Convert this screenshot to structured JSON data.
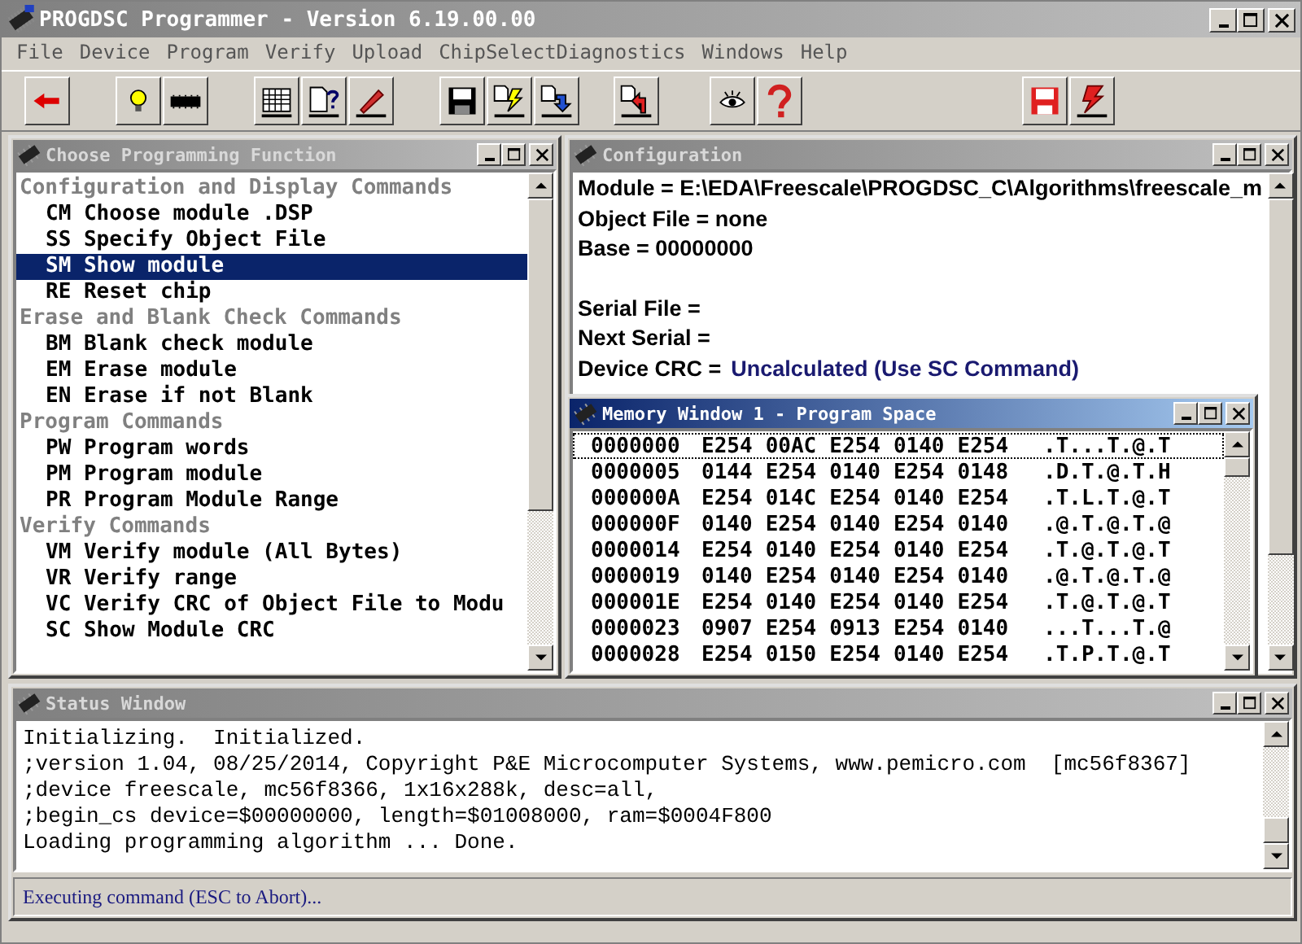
{
  "window": {
    "title": "PROGDSC Programmer - Version 6.19.00.00"
  },
  "menu": [
    "File",
    "Device",
    "Program",
    "Verify",
    "Upload",
    "ChipSelectDiagnostics",
    "Windows",
    "Help"
  ],
  "function_window": {
    "title": "Choose Programming Function",
    "active": false,
    "items": [
      {
        "kind": "header",
        "text": "Configuration and Display Commands",
        "selected": false
      },
      {
        "kind": "command",
        "text": "CM Choose module .DSP",
        "selected": false
      },
      {
        "kind": "command",
        "text": "SS Specify Object File",
        "selected": false
      },
      {
        "kind": "command",
        "text": "SM Show module",
        "selected": true
      },
      {
        "kind": "command",
        "text": "RE Reset chip",
        "selected": false
      },
      {
        "kind": "header",
        "text": "Erase and Blank Check Commands",
        "selected": false
      },
      {
        "kind": "command",
        "text": "BM Blank check module",
        "selected": false
      },
      {
        "kind": "command",
        "text": "EM Erase module",
        "selected": false
      },
      {
        "kind": "command",
        "text": "EN Erase if not Blank",
        "selected": false
      },
      {
        "kind": "header",
        "text": "Program Commands",
        "selected": false
      },
      {
        "kind": "command",
        "text": "PW Program words",
        "selected": false
      },
      {
        "kind": "command",
        "text": "PM Program module",
        "selected": false
      },
      {
        "kind": "command",
        "text": "PR Program Module Range",
        "selected": false
      },
      {
        "kind": "header",
        "text": "Verify Commands",
        "selected": false
      },
      {
        "kind": "command",
        "text": "VM Verify module (All Bytes)",
        "selected": false
      },
      {
        "kind": "command",
        "text": "VR Verify range",
        "selected": false
      },
      {
        "kind": "command",
        "text": "VC Verify CRC of Object File to Modu",
        "selected": false
      },
      {
        "kind": "command",
        "text": "SC Show Module CRC",
        "selected": false
      }
    ]
  },
  "config_window": {
    "title": "Configuration",
    "active": false,
    "groups": [
      [
        {
          "label": "Module = E:\\EDA\\Freescale\\PROGDSC_C\\Algorithms\\freescale_m"
        },
        {
          "label": "Object File = none"
        },
        {
          "label": "Base = 00000000"
        }
      ],
      [
        {
          "label": "Serial File ="
        },
        {
          "label": "Next Serial ="
        },
        {
          "label": "Device CRC =",
          "value": "Uncalculated (Use SC Command)"
        }
      ]
    ]
  },
  "memory_window": {
    "title": "Memory Window 1 - Program Space",
    "active": true,
    "rows": [
      {
        "address": "0000000",
        "words": [
          "E254",
          "00AC",
          "E254",
          "0140",
          "E254"
        ],
        "ascii": ".T...T.@.T",
        "focused": true
      },
      {
        "address": "0000005",
        "words": [
          "0144",
          "E254",
          "0140",
          "E254",
          "0148"
        ],
        "ascii": ".D.T.@.T.H",
        "focused": false
      },
      {
        "address": "000000A",
        "words": [
          "E254",
          "014C",
          "E254",
          "0140",
          "E254"
        ],
        "ascii": ".T.L.T.@.T",
        "focused": false
      },
      {
        "address": "000000F",
        "words": [
          "0140",
          "E254",
          "0140",
          "E254",
          "0140"
        ],
        "ascii": ".@.T.@.T.@",
        "focused": false
      },
      {
        "address": "0000014",
        "words": [
          "E254",
          "0140",
          "E254",
          "0140",
          "E254"
        ],
        "ascii": ".T.@.T.@.T",
        "focused": false
      },
      {
        "address": "0000019",
        "words": [
          "0140",
          "E254",
          "0140",
          "E254",
          "0140"
        ],
        "ascii": ".@.T.@.T.@",
        "focused": false
      },
      {
        "address": "000001E",
        "words": [
          "E254",
          "0140",
          "E254",
          "0140",
          "E254"
        ],
        "ascii": ".T.@.T.@.T",
        "focused": false
      },
      {
        "address": "0000023",
        "words": [
          "0907",
          "E254",
          "0913",
          "E254",
          "0140"
        ],
        "ascii": "...T...T.@",
        "focused": false
      },
      {
        "address": "0000028",
        "words": [
          "E254",
          "0150",
          "E254",
          "0140",
          "E254"
        ],
        "ascii": ".T.P.T.@.T",
        "focused": false
      }
    ]
  },
  "status_window": {
    "title": "Status Window",
    "active": false,
    "lines": [
      "Initializing.  Initialized.",
      ";version 1.04, 08/25/2014, Copyright P&E Microcomputer Systems, www.pemicro.com  [mc56f8367]",
      ";device freescale, mc56f8366, 1x16x288k, desc=all,",
      ";begin_cs device=$00000000, length=$01008000, ram=$0004F800",
      "Loading programming algorithm ... Done."
    ],
    "status_bar": "Executing command (ESC to Abort)..."
  }
}
